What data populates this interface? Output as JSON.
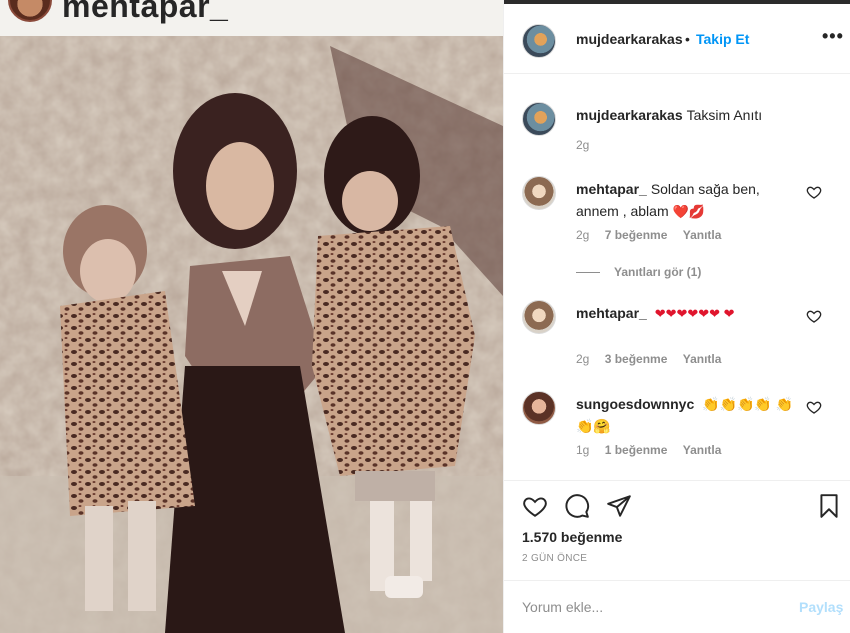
{
  "profile_strip": {
    "username": "mehtapar_"
  },
  "post_header": {
    "username": "mujdearkarakas",
    "separator": "•",
    "follow_label": "Takip Et",
    "more_label": "•••"
  },
  "caption": {
    "username": "mujdearkarakas",
    "text": "Taksim Anıtı",
    "time": "2g"
  },
  "comments": [
    {
      "username": "mehtapar_",
      "text": "Soldan sağa ben, annem , ablam",
      "emoji": "❤️💋",
      "time": "2g",
      "likes": "7 beğenme",
      "reply": "Yanıtla",
      "view_replies": "Yanıtları gör (1)"
    },
    {
      "username": "mehtapar_",
      "text": "",
      "emoji": "❤❤❤❤❤❤ ❤",
      "time": "2g",
      "likes": "3 beğenme",
      "reply": "Yanıtla"
    },
    {
      "username": "sungoesdownnyc",
      "text": "",
      "emoji": "👏👏👏👏 👏👏🤗",
      "time": "1g",
      "likes": "1 beğenme",
      "reply": "Yanıtla"
    }
  ],
  "actions": {
    "likes": "1.570 beğenme",
    "posted": "2 GÜN ÖNCE"
  },
  "comment_box": {
    "placeholder": "Yorum ekle...",
    "post_label": "Paylaş"
  },
  "icons": [
    "heart-icon",
    "comment-icon",
    "share-icon",
    "bookmark-icon",
    "more-icon"
  ],
  "colors": {
    "accent": "#0095f6",
    "text": "#262626",
    "muted": "#8e8e8e",
    "heart": "#e0152d"
  }
}
